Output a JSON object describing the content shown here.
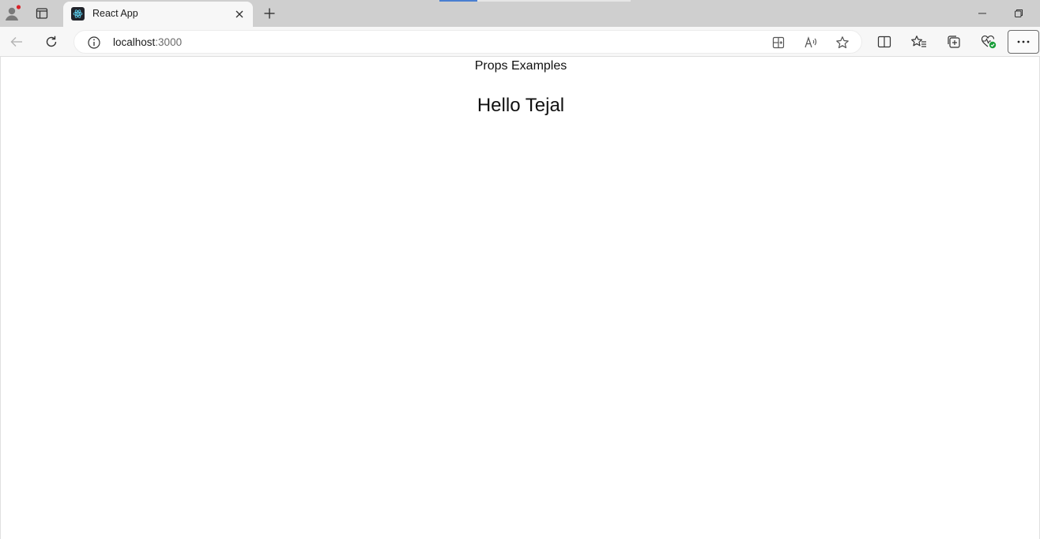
{
  "browser": {
    "tab": {
      "title": "React App"
    },
    "address": {
      "host": "localhost",
      "port": ":3000"
    }
  },
  "page": {
    "heading": "Props Examples",
    "greeting": "Hello Tejal"
  },
  "icons": {
    "profile": "profile-icon",
    "tabs": "tab-actions-icon",
    "favicon": "react-logo-icon",
    "close": "close-icon",
    "new_tab": "plus-icon",
    "minimize": "minimize-icon",
    "restore": "restore-icon",
    "back": "back-arrow-icon",
    "reload": "reload-icon",
    "info": "info-icon",
    "app_available": "app-available-icon",
    "read_aloud": "read-aloud-icon",
    "favorite": "star-icon",
    "split_screen": "split-screen-icon",
    "favorites": "favorites-icon",
    "collections": "collections-icon",
    "performance": "heart-pulse-icon",
    "more": "more-icon"
  },
  "colors": {
    "accent": "#4a7fd1",
    "favicon_bg": "#20232a",
    "react_blue": "#61dafb",
    "status_green": "#1a9e3a",
    "notification_red": "#d9242a"
  }
}
